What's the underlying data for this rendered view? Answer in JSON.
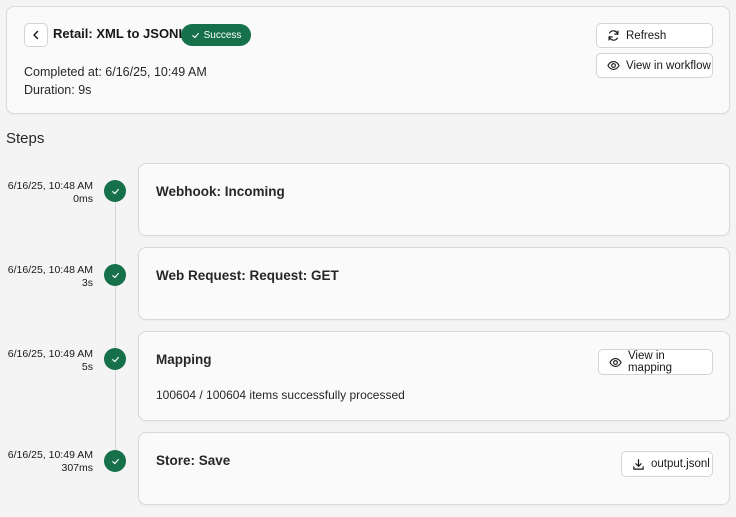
{
  "header": {
    "title": "Retail: XML to JSONL",
    "status_badge": "Success",
    "completed_at": "Completed at: 6/16/25, 10:49 AM",
    "duration": "Duration: 9s",
    "refresh_label": "Refresh",
    "view_workflow_label": "View in workflow"
  },
  "steps_heading": "Steps",
  "steps": [
    {
      "time": "6/16/25, 10:48 AM",
      "duration": "0ms",
      "title": "Webhook: Incoming"
    },
    {
      "time": "6/16/25, 10:48 AM",
      "duration": "3s",
      "title": "Web Request: Request: GET"
    },
    {
      "time": "6/16/25, 10:49 AM",
      "duration": "5s",
      "title": "Mapping",
      "description": "100604 / 100604 items successfully processed",
      "action_label": "View in mapping"
    },
    {
      "time": "6/16/25, 10:49 AM",
      "duration": "307ms",
      "title": "Store: Save",
      "action_label": "output.jsonl"
    }
  ],
  "colors": {
    "success": "#16704a",
    "border": "#d9d9dd",
    "background": "#f4f4f5"
  }
}
